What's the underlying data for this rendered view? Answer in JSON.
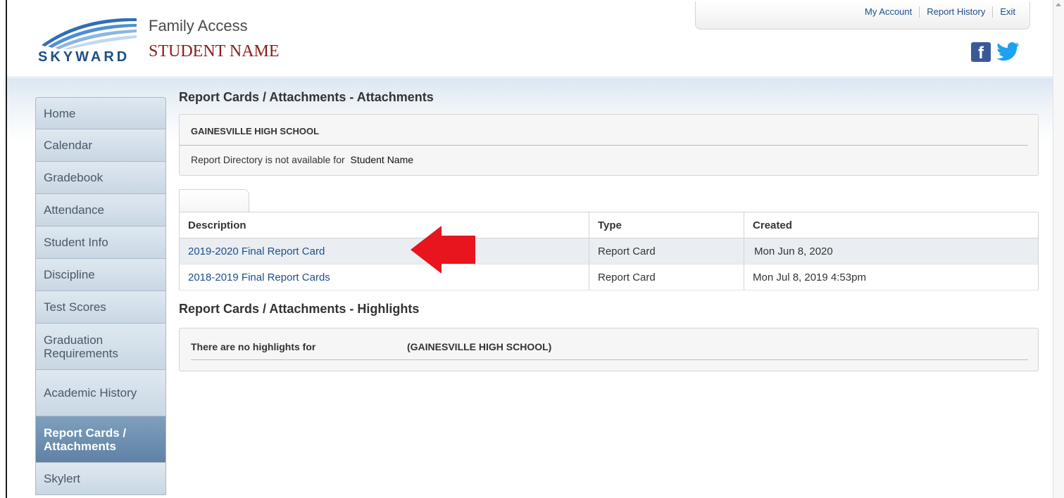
{
  "header": {
    "logo_text": "SKYWARD",
    "app_title": "Family Access",
    "student_name": "STUDENT NAME",
    "top_links": [
      "My Account",
      "Report History",
      "Exit"
    ],
    "social_icons": [
      "facebook-icon",
      "twitter-icon"
    ]
  },
  "sidebar": {
    "items": [
      {
        "label": "Home"
      },
      {
        "label": "Calendar"
      },
      {
        "label": "Gradebook"
      },
      {
        "label": "Attendance"
      },
      {
        "label": "Student Info"
      },
      {
        "label": "Discipline"
      },
      {
        "label": "Test Scores"
      },
      {
        "label": "Graduation Requirements"
      },
      {
        "label": "Academic History"
      },
      {
        "label": "Report Cards / Attachments",
        "active": true
      },
      {
        "label": "Skylert"
      }
    ]
  },
  "attachments": {
    "title": "Report Cards / Attachments - Attachments",
    "school": "GAINESVILLE HIGH SCHOOL",
    "message": "Report Directory is not available for",
    "student": "Student Name",
    "columns": [
      "Description",
      "Type",
      "Created"
    ],
    "rows": [
      {
        "description": "2019-2020  Final Report Card",
        "type": "Report Card",
        "created": "Mon Jun 8, 2020"
      },
      {
        "description": "2018-2019 Final Report Cards",
        "type": "Report Card",
        "created": "Mon Jul 8, 2019 4:53pm"
      }
    ]
  },
  "highlights": {
    "title": "Report Cards / Attachments - Highlights",
    "message": "There are no highlights for",
    "school": "(GAINESVILLE HIGH SCHOOL)"
  },
  "colors": {
    "link": "#1a4f8b",
    "student_name": "#8b1a1a",
    "annotation_arrow": "#e8141e",
    "nav_active": "#6d8fb1"
  }
}
